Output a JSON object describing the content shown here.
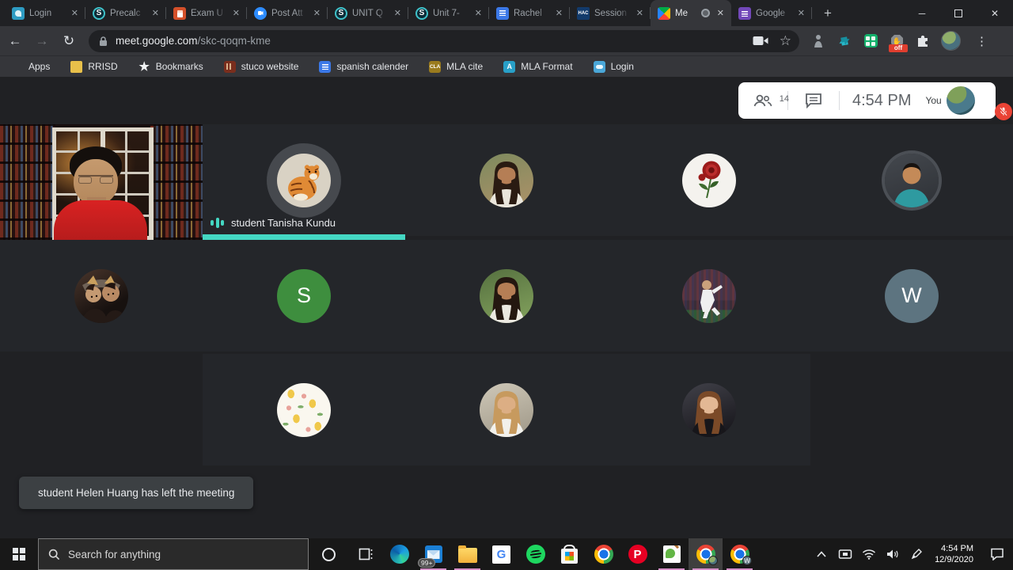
{
  "browser": {
    "tabs": [
      {
        "label": "Login",
        "icon": "login"
      },
      {
        "label": "Precalc",
        "icon": "schoology",
        "glyph": "S"
      },
      {
        "label": "Exam U",
        "icon": "exam"
      },
      {
        "label": "Post Att",
        "icon": "video"
      },
      {
        "label": "UNIT Q",
        "icon": "schoology",
        "glyph": "S"
      },
      {
        "label": "Unit 7-",
        "icon": "schoology",
        "glyph": "S"
      },
      {
        "label": "Rachel",
        "icon": "docs"
      },
      {
        "label": "Session",
        "icon": "hac",
        "glyph": "HAC"
      },
      {
        "label": "Me",
        "icon": "meet",
        "active": true,
        "recording": true
      },
      {
        "label": "Google",
        "icon": "forms"
      }
    ],
    "new_tab_label": "+",
    "window_controls": {
      "minimize": "─",
      "close": "✕"
    },
    "nav": {
      "back": "←",
      "forward": "→",
      "reload": "↻"
    },
    "address": {
      "host": "meet.google.com",
      "path": "/skc-qoqm-kme"
    },
    "star_glyph": "☆",
    "menu_glyph": "⋮",
    "adblock_badge": "off",
    "bookmarks": [
      {
        "label": "Apps",
        "icon": "apps"
      },
      {
        "label": "RRISD",
        "icon": "folder"
      },
      {
        "label": "Bookmarks",
        "icon": "star",
        "glyph": "★"
      },
      {
        "label": "stuco website",
        "icon": "stuco"
      },
      {
        "label": "spanish calender",
        "icon": "doc"
      },
      {
        "label": "MLA cite",
        "icon": "cla",
        "glyph": "CLA"
      },
      {
        "label": "MLA Format",
        "icon": "abox",
        "glyph": "A"
      },
      {
        "label": "Login",
        "icon": "cloud"
      }
    ]
  },
  "meet": {
    "participants_count": "14",
    "clock": "4:54 PM",
    "you_label": "You",
    "speaker": {
      "name": "student Tanisha Kundu"
    },
    "toast": "student Helen Huang has left the meeting",
    "colors": {
      "accent_teal": "#44d7c3",
      "mic_badge_red": "#ea4335",
      "letter_green": "#3e8e3e",
      "letter_slate": "#5d7480"
    },
    "participants": [
      {
        "kind": "tiger",
        "row": 0,
        "col": 1,
        "ring": "thick"
      },
      {
        "kind": "person",
        "row": 0,
        "col": 2,
        "bg": "#7d8a5e,#ad9168",
        "hair": "#2a1b12",
        "skin": "#b57e55",
        "shirt": "#eae6dc",
        "long_hair": true
      },
      {
        "kind": "rose",
        "row": 0,
        "col": 3
      },
      {
        "kind": "person",
        "row": 0,
        "col": 4,
        "bg": "#44484e,#2e3136",
        "hair": "#181310",
        "skin": "#c48a58",
        "shirt": "#2e9aa0",
        "ring": "thin"
      },
      {
        "kind": "duo",
        "row": 1,
        "col": 0
      },
      {
        "kind": "letter",
        "row": 1,
        "col": 1,
        "glyph": "S",
        "bg": "#3e8e3e"
      },
      {
        "kind": "person",
        "row": 1,
        "col": 2,
        "bg": "#55703f,#84a35e",
        "hair": "#241710",
        "skin": "#b57e55",
        "shirt": "#ece9e1",
        "long_hair": true
      },
      {
        "kind": "soccer",
        "row": 1,
        "col": 3
      },
      {
        "kind": "letter",
        "row": 1,
        "col": 4,
        "glyph": "W",
        "bg": "#5d7480"
      },
      {
        "kind": "pineapple",
        "row": 2,
        "col": 1
      },
      {
        "kind": "person",
        "row": 2,
        "col": 2,
        "bg": "#cfc8b8,#9e9787",
        "hair": "#c79a5e",
        "skin": "#dcae84",
        "shirt": "#f2f1ec",
        "long_hair": true
      },
      {
        "kind": "person",
        "row": 2,
        "col": 3,
        "bg": "#414149,#141318",
        "hair": "#7b4a28",
        "skin": "#e3b894",
        "shirt": "#17161a",
        "long_hair": true
      }
    ]
  },
  "taskbar": {
    "search_placeholder": "Search for anything",
    "mail_badge": "99+",
    "chrome2_badge": "W",
    "time": "4:54 PM",
    "date": "12/9/2020"
  }
}
